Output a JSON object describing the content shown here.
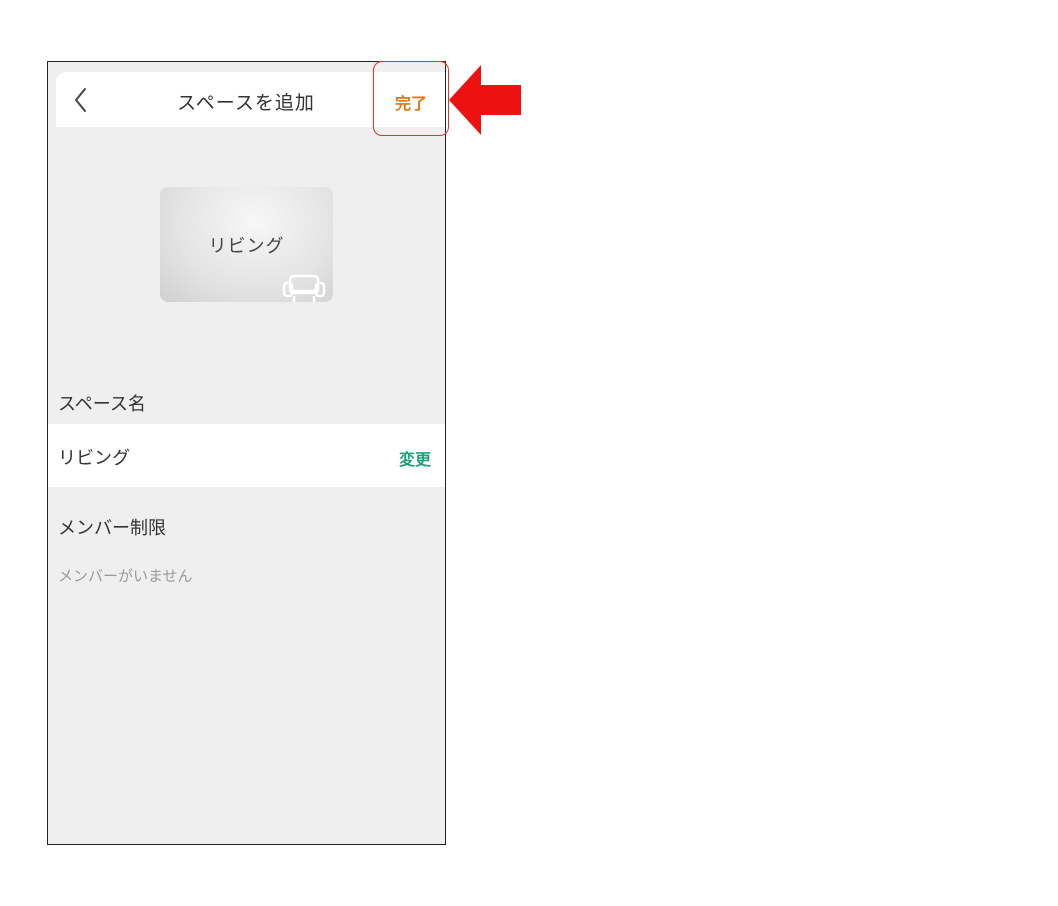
{
  "header": {
    "title": "スペースを追加",
    "done_label": "完了"
  },
  "space_card": {
    "label": "リビング",
    "icon": "sofa-icon"
  },
  "space_name_section": {
    "label": "スペース名",
    "value": "リビング",
    "change_label": "変更"
  },
  "member_section": {
    "label": "メンバー制限",
    "empty_text": "メンバーがいません"
  },
  "colors": {
    "accent_orange": "#e8720c",
    "accent_green": "#1aa37a",
    "annotation_red": "#e8332b"
  }
}
